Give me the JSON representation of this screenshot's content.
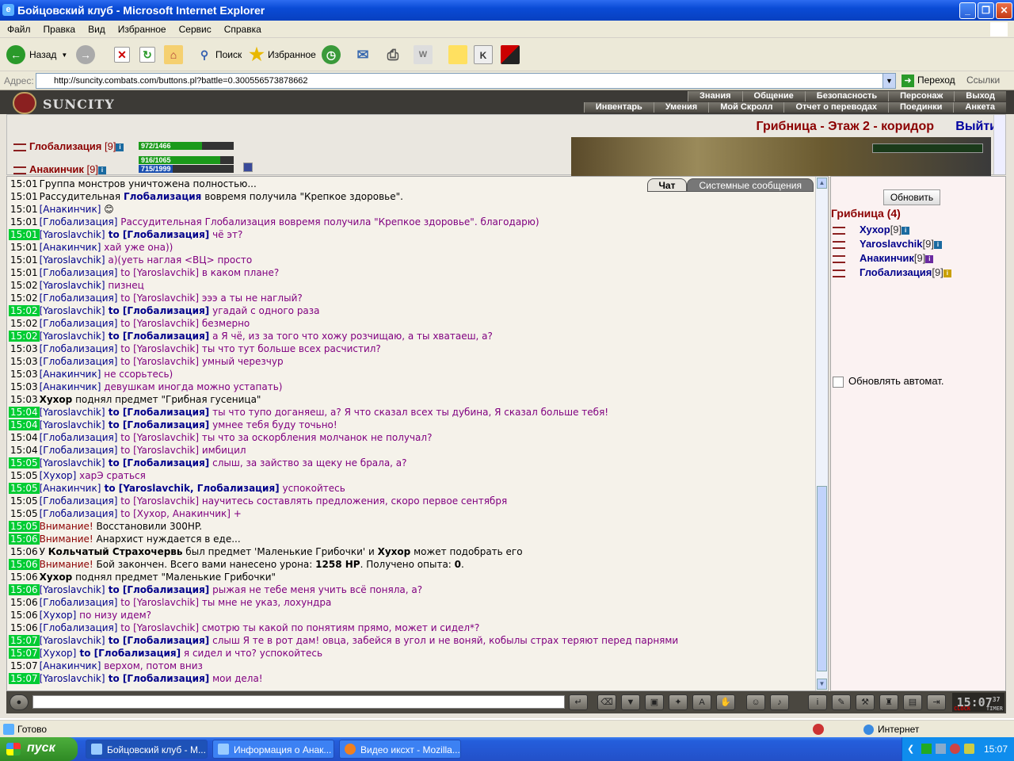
{
  "window": {
    "title": "Бойцовский клуб - Microsoft Internet Explorer",
    "min_icon": "minimize-icon",
    "max_icon": "maximize-icon",
    "close_icon": "close-icon"
  },
  "menu": [
    "Файл",
    "Правка",
    "Вид",
    "Избранное",
    "Сервис",
    "Справка"
  ],
  "toolbar": {
    "back": "Назад",
    "search": "Поиск",
    "favorites": "Избранное"
  },
  "address": {
    "label": "Адрес:",
    "url": "http://suncity.combats.com/buttons.pl?battle=0.300556573878662",
    "go": "Переход",
    "links": "Ссылки"
  },
  "game": {
    "logo": "SUNCITY",
    "nav_top": [
      "Знания",
      "Общение",
      "Безопасность",
      "Персонаж",
      "Выход"
    ],
    "nav_bottom": [
      "Инвентарь",
      "Умения",
      "Мой Скролл",
      "Отчет о переводах",
      "Поединки",
      "Анкета"
    ],
    "location": "Грибница - Этаж 2 - коридор",
    "exit": "Выйти",
    "players": [
      {
        "name": "Глобализация",
        "level": "[9]",
        "hp": "972/1466",
        "hp_frac": 0.663
      },
      {
        "name": "Анакинчик",
        "level": "[9]",
        "hp": "916/1065",
        "hp_frac": 0.86,
        "mana": "715/1999",
        "mana_frac": 0.358
      }
    ],
    "tabs": {
      "chat": "Чат",
      "system": "Системные сообщения"
    },
    "side": {
      "refresh": "Обновить",
      "room": "Грибница (4)",
      "people": [
        {
          "name": "Хухор",
          "level": "[9]"
        },
        {
          "name": "Yaroslavchik",
          "level": "[9]"
        },
        {
          "name": "Анакинчик",
          "level": "[9]"
        },
        {
          "name": "Глобализация",
          "level": "[9]"
        }
      ],
      "auto": "Обновлять автомат."
    },
    "clock": {
      "time": "15:07",
      "sec": "37",
      "l1": "CLOCK",
      "l2": "TIMER"
    }
  },
  "chat": [
    {
      "t": "15:01",
      "hl": false,
      "parts": [
        [
          "",
          "Группа монстров уничтожена полностью..."
        ]
      ]
    },
    {
      "t": "15:01",
      "hl": false,
      "parts": [
        [
          "",
          "Рассудительная "
        ],
        [
          "to",
          "Глобализация"
        ],
        [
          "",
          " вовремя получила \"Крепкое здоровье\"."
        ]
      ]
    },
    {
      "t": "15:01",
      "hl": false,
      "parts": [
        [
          "nm",
          "[Анакинчик]"
        ],
        [
          "",
          " 😊"
        ]
      ]
    },
    {
      "t": "15:01",
      "hl": false,
      "parts": [
        [
          "nm",
          "[Глобализация]"
        ],
        [
          "pm",
          " Рассудительная Глобализация вовремя получила \"Крепкое здоровье\". благодарю)"
        ]
      ]
    },
    {
      "t": "15:01",
      "hl": true,
      "parts": [
        [
          "nm",
          "[Yaroslavchik]"
        ],
        [
          "to",
          " to [Глобализация]"
        ],
        [
          "pm",
          " чё эт?"
        ]
      ]
    },
    {
      "t": "15:01",
      "hl": false,
      "parts": [
        [
          "nm",
          "[Анакинчик]"
        ],
        [
          "pm",
          " хай уже она))"
        ]
      ]
    },
    {
      "t": "15:01",
      "hl": false,
      "parts": [
        [
          "nm",
          "[Yaroslavchik]"
        ],
        [
          "pm",
          " а)(уеть наглая <ВЦ> просто"
        ]
      ]
    },
    {
      "t": "15:01",
      "hl": false,
      "parts": [
        [
          "nm",
          "[Глобализация]"
        ],
        [
          "pm",
          " to [Yaroslavchik] в каком плане?"
        ]
      ]
    },
    {
      "t": "15:02",
      "hl": false,
      "parts": [
        [
          "nm",
          "[Yaroslavchik]"
        ],
        [
          "pm",
          " пизнец"
        ]
      ]
    },
    {
      "t": "15:02",
      "hl": false,
      "parts": [
        [
          "nm",
          "[Глобализация]"
        ],
        [
          "pm",
          " to [Yaroslavchik] эээ а ты не наглый?"
        ]
      ]
    },
    {
      "t": "15:02",
      "hl": true,
      "parts": [
        [
          "nm",
          "[Yaroslavchik]"
        ],
        [
          "to",
          " to [Глобализация]"
        ],
        [
          "pm",
          " угадай с одного раза"
        ]
      ]
    },
    {
      "t": "15:02",
      "hl": false,
      "parts": [
        [
          "nm",
          "[Глобализация]"
        ],
        [
          "pm",
          " to [Yaroslavchik] безмерно"
        ]
      ]
    },
    {
      "t": "15:02",
      "hl": true,
      "parts": [
        [
          "nm",
          "[Yaroslavchik]"
        ],
        [
          "to",
          " to [Глобализация]"
        ],
        [
          "pm",
          " а Я чё, из за того что хожу розчищаю, а ты хватаеш, а?"
        ]
      ]
    },
    {
      "t": "15:03",
      "hl": false,
      "parts": [
        [
          "nm",
          "[Глобализация]"
        ],
        [
          "pm",
          " to [Yaroslavchik] ты что тут больше всех расчистил?"
        ]
      ]
    },
    {
      "t": "15:03",
      "hl": false,
      "parts": [
        [
          "nm",
          "[Глобализация]"
        ],
        [
          "pm",
          " to [Yaroslavchik] умный черезчур"
        ]
      ]
    },
    {
      "t": "15:03",
      "hl": false,
      "parts": [
        [
          "nm",
          "[Анакинчик]"
        ],
        [
          "pm",
          " не ссорьтесь)"
        ]
      ]
    },
    {
      "t": "15:03",
      "hl": false,
      "parts": [
        [
          "nm",
          "[Анакинчик]"
        ],
        [
          "pm",
          " девушкам иногда можно устапать)"
        ]
      ]
    },
    {
      "t": "15:03",
      "hl": false,
      "parts": [
        [
          "b",
          "Хухор"
        ],
        [
          "",
          " поднял предмет \"Грибная гусеница\""
        ]
      ]
    },
    {
      "t": "15:04",
      "hl": true,
      "parts": [
        [
          "nm",
          "[Yaroslavchik]"
        ],
        [
          "to",
          " to [Глобализация]"
        ],
        [
          "pm",
          " ты что тупо доганяеш, а? Я что сказал всех ты дубина, Я сказал больше тебя!"
        ]
      ]
    },
    {
      "t": "15:04",
      "hl": true,
      "parts": [
        [
          "nm",
          "[Yaroslavchik]"
        ],
        [
          "to",
          " to [Глобализация]"
        ],
        [
          "pm",
          " умнее тебя буду точьно!"
        ]
      ]
    },
    {
      "t": "15:04",
      "hl": false,
      "parts": [
        [
          "nm",
          "[Глобализация]"
        ],
        [
          "pm",
          " to [Yaroslavchik] ты что за оскорбления молчанок не получал?"
        ]
      ]
    },
    {
      "t": "15:04",
      "hl": false,
      "parts": [
        [
          "nm",
          "[Глобализация]"
        ],
        [
          "pm",
          " to [Yaroslavchik] имбицил"
        ]
      ]
    },
    {
      "t": "15:05",
      "hl": true,
      "parts": [
        [
          "nm",
          "[Yaroslavchik]"
        ],
        [
          "to",
          " to [Глобализация]"
        ],
        [
          "pm",
          " слыш, за зайство за щеку не брала, а?"
        ]
      ]
    },
    {
      "t": "15:05",
      "hl": false,
      "parts": [
        [
          "nm",
          "[Хухор]"
        ],
        [
          "pm",
          " харЭ сраться"
        ]
      ]
    },
    {
      "t": "15:05",
      "hl": true,
      "parts": [
        [
          "nm",
          "[Анакинчик]"
        ],
        [
          "to",
          " to [Yaroslavchik, Глобализация]"
        ],
        [
          "pm",
          " успокойтесь"
        ]
      ]
    },
    {
      "t": "15:05",
      "hl": false,
      "parts": [
        [
          "nm",
          "[Глобализация]"
        ],
        [
          "pm",
          " to [Yaroslavchik] научитесь составлять предложения, скоро первое сентября"
        ]
      ]
    },
    {
      "t": "15:05",
      "hl": false,
      "parts": [
        [
          "nm",
          "[Глобализация]"
        ],
        [
          "pm",
          " to [Хухор, Анакинчик] +"
        ]
      ]
    },
    {
      "t": "15:05",
      "hl": true,
      "parts": [
        [
          "sys",
          "Внимание!"
        ],
        [
          "",
          " Восстановили 300HP."
        ]
      ]
    },
    {
      "t": "15:06",
      "hl": true,
      "parts": [
        [
          "sys",
          "Внимание!"
        ],
        [
          "",
          " Анархист нуждается в еде..."
        ]
      ]
    },
    {
      "t": "15:06",
      "hl": false,
      "parts": [
        [
          "",
          "У "
        ],
        [
          "b",
          "Кольчатый Страхочервь"
        ],
        [
          "",
          " был предмет 'Маленькие Грибочки' и "
        ],
        [
          "b",
          "Хухор"
        ],
        [
          "",
          " может подобрать его"
        ]
      ]
    },
    {
      "t": "15:06",
      "hl": true,
      "parts": [
        [
          "sys",
          "Внимание!"
        ],
        [
          "",
          " Бой закончен. Всего вами нанесено урона: "
        ],
        [
          "b",
          "1258 HP"
        ],
        [
          "",
          ". Получено опыта: "
        ],
        [
          "b",
          "0"
        ],
        [
          "",
          "."
        ]
      ]
    },
    {
      "t": "15:06",
      "hl": false,
      "parts": [
        [
          "b",
          "Хухор"
        ],
        [
          "",
          " поднял предмет \"Маленькие Грибочки\""
        ]
      ]
    },
    {
      "t": "15:06",
      "hl": true,
      "parts": [
        [
          "nm",
          "[Yaroslavchik]"
        ],
        [
          "to",
          " to [Глобализация]"
        ],
        [
          "pm",
          " рыжая не тебе меня учить всё поняла, а?"
        ]
      ]
    },
    {
      "t": "15:06",
      "hl": false,
      "parts": [
        [
          "nm",
          "[Глобализация]"
        ],
        [
          "pm",
          " to [Yaroslavchik] ты мне не указ, лохундра"
        ]
      ]
    },
    {
      "t": "15:06",
      "hl": false,
      "parts": [
        [
          "nm",
          "[Хухор]"
        ],
        [
          "pm",
          " по низу идем?"
        ]
      ]
    },
    {
      "t": "15:06",
      "hl": false,
      "parts": [
        [
          "nm",
          "[Глобализация]"
        ],
        [
          "pm",
          " to [Yaroslavchik] смотрю ты какой по понятиям прямо, может и сидел*?"
        ]
      ]
    },
    {
      "t": "15:07",
      "hl": true,
      "parts": [
        [
          "nm",
          "[Yaroslavchik]"
        ],
        [
          "to",
          " to [Глобализация]"
        ],
        [
          "pm",
          " слыш Я те в рот дам! овца, забейся в угол и не воняй, кобылы страх теряют перед парнями"
        ]
      ]
    },
    {
      "t": "15:07",
      "hl": true,
      "parts": [
        [
          "nm",
          "[Хухор]"
        ],
        [
          "to",
          " to [Глобализация]"
        ],
        [
          "pm",
          " я сидел и что? успокойтесь"
        ]
      ]
    },
    {
      "t": "15:07",
      "hl": false,
      "parts": [
        [
          "nm",
          "[Анакинчик]"
        ],
        [
          "pm",
          " верхом, потом вниз"
        ]
      ]
    },
    {
      "t": "15:07",
      "hl": true,
      "parts": [
        [
          "nm",
          "[Yaroslavchik]"
        ],
        [
          "to",
          " to [Глобализация]"
        ],
        [
          "pm",
          " мои дела!"
        ]
      ]
    }
  ],
  "status": {
    "text": "Готово",
    "zone": "Интернет"
  },
  "taskbar": {
    "start": "пуск",
    "tasks": [
      "Бойцовский клуб - M...",
      "Информация о Анак...",
      "Видео иксхт - Mozilla..."
    ],
    "clock": "15:07"
  }
}
